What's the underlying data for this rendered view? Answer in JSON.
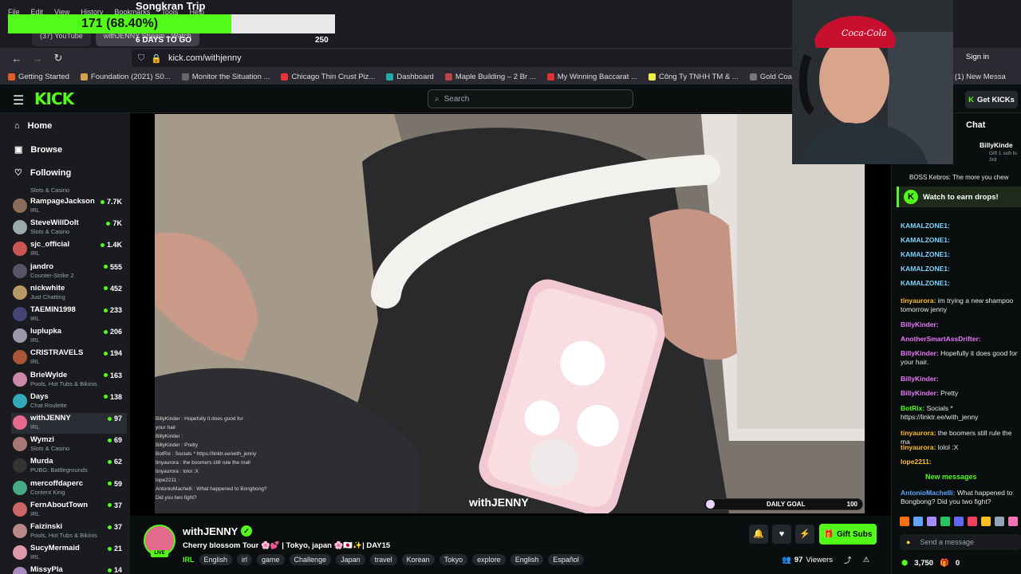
{
  "browser": {
    "menu": [
      "File",
      "Edit",
      "View",
      "History",
      "Bookmarks",
      "Tools",
      "Help"
    ],
    "tabs": [
      "(37) YouTube",
      "withJENNY Stream - Watch"
    ],
    "url": "kick.com/withjenny",
    "sign_in": "Sign in",
    "bookmarks": [
      {
        "label": "Getting Started",
        "color": "#e55b2d"
      },
      {
        "label": "Foundation (2021) S0...",
        "color": "#d4a24c"
      },
      {
        "label": "Monitor the Situation ...",
        "color": "#666"
      },
      {
        "label": "Chicago Thin Crust Piz...",
        "color": "#e33"
      },
      {
        "label": "Dashboard",
        "color": "#2aa"
      },
      {
        "label": "Maple Building – 2 Br ...",
        "color": "#b44"
      },
      {
        "label": "My Winning Baccarat ...",
        "color": "#d33"
      },
      {
        "label": "Công Ty TNHH TM & ...",
        "color": "#ee4"
      },
      {
        "label": "Gold Coast – Luxury Li...",
        "color": "#777"
      },
      {
        "label": "Sign in · DreamHost",
        "color": "#36c"
      },
      {
        "label": "(1) New Messa",
        "color": "#ec3"
      }
    ]
  },
  "goal_overlay": {
    "title": "Songkran Trip",
    "progress_text": "171 (68.40%)",
    "progress": 0.684,
    "days_left": "6 DAYS TO GO",
    "target": "250"
  },
  "header": {
    "logo": "KICK",
    "search_placeholder": "Search",
    "get_kicks": "Get KICKs"
  },
  "sidebar": {
    "nav": [
      {
        "label": "Home",
        "icon": "home-icon"
      },
      {
        "label": "Browse",
        "icon": "browse-icon"
      },
      {
        "label": "Following",
        "icon": "heart-icon"
      }
    ],
    "partial_top_category": "Slots & Casino",
    "channels": [
      {
        "name": "RampageJackson",
        "category": "IRL",
        "viewers": "7.7K",
        "color": "#8a6d5a"
      },
      {
        "name": "SteveWillDoIt",
        "category": "Slots & Casino",
        "viewers": "7K",
        "color": "#9aa"
      },
      {
        "name": "sjc_official",
        "category": "IRL",
        "viewers": "1.4K",
        "color": "#c55"
      },
      {
        "name": "jandro",
        "category": "Counter-Strike 2",
        "viewers": "555",
        "color": "#556"
      },
      {
        "name": "nickwhite",
        "category": "Just Chatting",
        "viewers": "452",
        "color": "#b96"
      },
      {
        "name": "TAEMIN1998",
        "category": "IRL",
        "viewers": "233",
        "color": "#447"
      },
      {
        "name": "luplupka",
        "category": "IRL",
        "viewers": "206",
        "color": "#99a"
      },
      {
        "name": "CRISTRAVELS",
        "category": "IRL",
        "viewers": "194",
        "color": "#a53"
      },
      {
        "name": "BrieWylde",
        "category": "Pools, Hot Tubs & Bikinis",
        "viewers": "163",
        "color": "#c8a"
      },
      {
        "name": "Days",
        "category": "Chat Roulette",
        "viewers": "138",
        "color": "#3ab"
      },
      {
        "name": "withJENNY",
        "category": "IRL",
        "viewers": "97",
        "color": "#e56a8d"
      },
      {
        "name": "Wymzi",
        "category": "Slots & Casino",
        "viewers": "69",
        "color": "#a77"
      },
      {
        "name": "Murda",
        "category": "PUBG: Battlegrounds",
        "viewers": "62",
        "color": "#333"
      },
      {
        "name": "mercoffdaperc",
        "category": "Content King",
        "viewers": "59",
        "color": "#4a8"
      },
      {
        "name": "FernAboutTown",
        "category": "IRL",
        "viewers": "37",
        "color": "#c66"
      },
      {
        "name": "Faizinski",
        "category": "Pools, Hot Tubs & Bikinis",
        "viewers": "37",
        "color": "#b88"
      },
      {
        "name": "SucyMermaid",
        "category": "IRL",
        "viewers": "21",
        "color": "#d9a"
      },
      {
        "name": "MissyPla",
        "category": "",
        "viewers": "14",
        "color": "#a8b"
      }
    ]
  },
  "video": {
    "watermark": "withJENNY",
    "daily_goal_label": "DAILY GOAL",
    "daily_goal_value": "100",
    "overlay_chat": [
      "BillyKinder : Hopefully it does good for",
      "your hair",
      "BillyKinder :",
      "BillyKinder : Pretty",
      "BotRix : Socials * https://linktr.ee/with_jenny",
      "tinyaurora : the boomers still rule the mall",
      "tinyaurora : lolol :X",
      "lope2211 :",
      "AntonioMachelli : What happened to Bongbong?",
      "Did you two fight?"
    ]
  },
  "stream": {
    "name": "withJENNY",
    "live": "LIVE",
    "title": "Cherry blossom Tour 🌸💕 | Tokyo, japan 🌸🇯🇵✨| DAY15",
    "category": "IRL",
    "tags": [
      "English",
      "irl",
      "game",
      "Challenge",
      "Japan",
      "travel",
      "Korean",
      "Tokyo",
      "explore",
      "English",
      "Español"
    ],
    "gift_subs": "Gift Subs",
    "viewers": "97",
    "viewers_label": "Viewers"
  },
  "chat": {
    "title": "Chat",
    "pinned_user": "BillyKinde",
    "pinned_sub": "Gift 1 sub to",
    "pinned_sub2": "3rd",
    "partial_top": "BOSS Kebros: The more you chew",
    "drops_banner": "Watch to earn drops!",
    "messages": [
      {
        "user": "KAMALZONE1:",
        "text": "",
        "color": "#7dd3fc"
      },
      {
        "user": "KAMALZONE1:",
        "text": "",
        "color": "#7dd3fc"
      },
      {
        "user": "KAMALZONE1:",
        "text": "",
        "color": "#7dd3fc"
      },
      {
        "user": "KAMALZONE1:",
        "text": "",
        "color": "#7dd3fc"
      },
      {
        "user": "KAMALZONE1:",
        "text": "",
        "color": "#7dd3fc"
      },
      {
        "user": "tinyaurora:",
        "text": "im trying a new shampoo tomorrow jenny",
        "color": "#fbbf24"
      },
      {
        "user": "BillyKinder:",
        "text": "",
        "color": "#e879f9"
      },
      {
        "user": "AnotherSmartAssDrifter:",
        "text": "",
        "color": "#e879f9"
      },
      {
        "user": "BillyKinder:",
        "text": "Hopefully it does good for your hair.",
        "color": "#e879f9"
      },
      {
        "user": "BillyKinder:",
        "text": "",
        "color": "#e879f9"
      },
      {
        "user": "BillyKinder:",
        "text": "Pretty",
        "color": "#e879f9"
      },
      {
        "user": "BotRix:",
        "text": "Socials * https://linktr.ee/with_jenny",
        "color": "#53fc18"
      },
      {
        "user": "tinyaurora:",
        "text": "the boomers still rule the ma",
        "color": "#fbbf24"
      },
      {
        "user": "tinyaurora:",
        "text": "lolol :X",
        "color": "#fbbf24"
      },
      {
        "user": "lope2211:",
        "text": "",
        "color": "#fbbf24"
      }
    ],
    "new_messages": "New messages",
    "last_message": {
      "user": "AntonioMachelli:",
      "text": "What happened to Bongbong? Did you two fight?",
      "color": "#60a5fa"
    },
    "send_placeholder": "Send a message",
    "kicks_balance": "3,750",
    "other_count": "0"
  }
}
